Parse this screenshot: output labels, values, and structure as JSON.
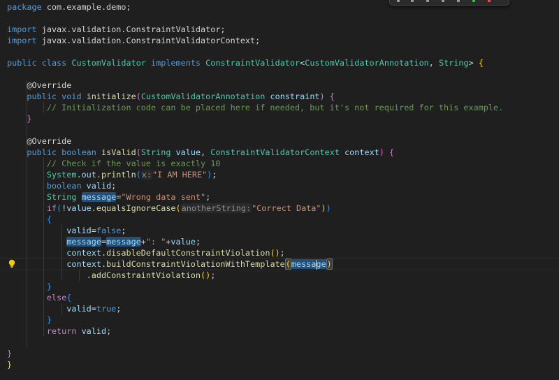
{
  "code": {
    "package_kw": "package",
    "package_name": "com.example.demo;",
    "import_kw": "import",
    "import1": "javax.validation.ConstraintValidator;",
    "import2": "javax.validation.ConstraintValidatorContext;",
    "public_kw": "public",
    "class_kw": "class",
    "implements_kw": "implements",
    "void_kw": "void",
    "boolean_kw": "boolean",
    "if_kw": "if",
    "else_kw": "else",
    "return_kw": "return",
    "false_kw": "false",
    "true_kw": "true",
    "class_name": "CustomValidator",
    "interface_name": "ConstraintValidator",
    "annotation_type": "CustomValidatorAnnotation",
    "string_type": "String",
    "context_type": "ConstraintValidatorContext",
    "override": "@Override",
    "initialize_fn": "initialize",
    "constraint_param": "constraint",
    "init_comment": "// Initialization code can be placed here if needed, but it's not required for this example.",
    "isvalid_fn": "isValid",
    "value_param": "value",
    "context_param": "context",
    "check_comment": "// Check if the value is exactly 10",
    "system": "System",
    "out": "out",
    "println_fn": "println",
    "hint_x": "x:",
    "str_i_am_here": "\"I AM HERE\"",
    "valid_var": "valid",
    "message_var": "message",
    "str_wrong_data": "\"Wrong data sent\"",
    "equals_fn": "equalsIgnoreCase",
    "hint_another": "anotherString:",
    "str_correct_data": "\"Correct Data\"",
    "str_colon": "\": \"",
    "disable_fn": "disableDefaultConstraintViolation",
    "build_fn": "buildConstraintViolationWithTemplate",
    "add_fn": "addConstraintViolation"
  },
  "colors": {
    "background": "#1f1f1f",
    "keyword": "#569cd6",
    "control_keyword": "#c586c0",
    "type": "#4ec9b0",
    "function": "#dcdcaa",
    "string": "#ce9178",
    "comment": "#6a9955",
    "variable": "#9cdcfe",
    "bracket_gold": "#ffd700",
    "bracket_orchid": "#da70d6",
    "bracket_blue": "#179fff"
  },
  "icons": {
    "gutter": "lightbulb-icon"
  }
}
